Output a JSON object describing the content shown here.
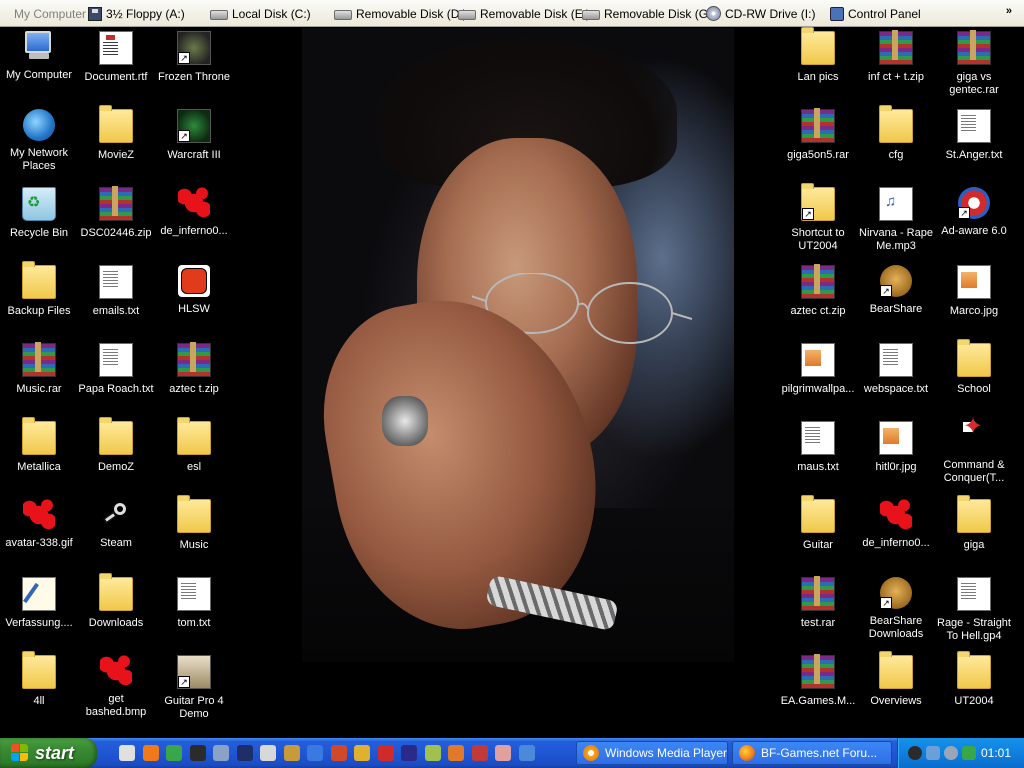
{
  "toolbar": {
    "items": [
      {
        "label": "My Computer",
        "icon": "computer-icon"
      },
      {
        "label": "3½ Floppy (A:)",
        "icon": "floppy-icon"
      },
      {
        "label": "Local Disk (C:)",
        "icon": "drive-icon"
      },
      {
        "label": "Removable Disk (D:)",
        "icon": "drive-icon"
      },
      {
        "label": "Removable Disk (E:)",
        "icon": "drive-icon"
      },
      {
        "label": "Removable Disk (G:)",
        "icon": "drive-icon"
      },
      {
        "label": "CD-RW Drive (I:)",
        "icon": "cd-icon"
      },
      {
        "label": "Control Panel",
        "icon": "control-panel-icon"
      }
    ],
    "more": "»"
  },
  "desktop": {
    "left_icons": [
      {
        "label": "My Computer",
        "icon": "my-computer-icon"
      },
      {
        "label": "Document.rtf",
        "icon": "document-icon"
      },
      {
        "label": "Frozen Throne",
        "icon": "frozen-throne-icon"
      },
      {
        "label": "My Network Places",
        "icon": "network-icon"
      },
      {
        "label": "MovieZ",
        "icon": "folder-icon"
      },
      {
        "label": "Warcraft III",
        "icon": "warcraft-icon"
      },
      {
        "label": "Recycle Bin",
        "icon": "recycle-bin-icon"
      },
      {
        "label": "DSC02446.zip",
        "icon": "archive-icon"
      },
      {
        "label": "de_inferno0...",
        "icon": "splat-icon"
      },
      {
        "label": "Backup Files",
        "icon": "folder-icon"
      },
      {
        "label": "emails.txt",
        "icon": "text-file-icon"
      },
      {
        "label": "HLSW",
        "icon": "hlsw-icon"
      },
      {
        "label": "Music.rar",
        "icon": "archive-icon"
      },
      {
        "label": "Papa Roach.txt",
        "icon": "text-file-icon"
      },
      {
        "label": "aztec t.zip",
        "icon": "archive-icon"
      },
      {
        "label": "Metallica",
        "icon": "folder-icon"
      },
      {
        "label": "DemoZ",
        "icon": "folder-icon"
      },
      {
        "label": "esl",
        "icon": "folder-icon"
      },
      {
        "label": "avatar-338.gif",
        "icon": "splat-icon"
      },
      {
        "label": "Steam",
        "icon": "steam-icon"
      },
      {
        "label": "Music",
        "icon": "folder-icon"
      },
      {
        "label": "Verfassung....",
        "icon": "pen-document-icon"
      },
      {
        "label": "Downloads",
        "icon": "folder-icon"
      },
      {
        "label": "tom.txt",
        "icon": "text-file-icon"
      },
      {
        "label": "4ll",
        "icon": "folder-icon"
      },
      {
        "label": "get bashed.bmp",
        "icon": "splat-icon"
      },
      {
        "label": "Guitar Pro 4 Demo",
        "icon": "guitar-pro-icon"
      }
    ],
    "right_icons": [
      {
        "label": "Lan pics",
        "icon": "folder-icon"
      },
      {
        "label": "inf ct + t.zip",
        "icon": "archive-icon"
      },
      {
        "label": "giga vs gentec.rar",
        "icon": "archive-icon"
      },
      {
        "label": "giga5on5.rar",
        "icon": "archive-icon"
      },
      {
        "label": "cfg",
        "icon": "folder-icon"
      },
      {
        "label": "St.Anger.txt",
        "icon": "text-file-icon"
      },
      {
        "label": "Shortcut to UT2004",
        "icon": "folder-icon"
      },
      {
        "label": "Nirvana - Rape Me.mp3",
        "icon": "mp3-icon"
      },
      {
        "label": "Ad-aware 6.0",
        "icon": "adaware-icon"
      },
      {
        "label": "aztec ct.zip",
        "icon": "archive-icon"
      },
      {
        "label": "BearShare",
        "icon": "bearshare-icon"
      },
      {
        "label": "Marco.jpg",
        "icon": "image-file-icon"
      },
      {
        "label": "pilgrimwallpa...",
        "icon": "image-file-icon"
      },
      {
        "label": "webspace.txt",
        "icon": "text-file-icon"
      },
      {
        "label": "School",
        "icon": "folder-icon"
      },
      {
        "label": "maus.txt",
        "icon": "text-file-icon"
      },
      {
        "label": "hitl0r.jpg",
        "icon": "image-file-icon"
      },
      {
        "label": "Command & Conquer(T...",
        "icon": "command-conquer-icon"
      },
      {
        "label": "Guitar",
        "icon": "folder-icon"
      },
      {
        "label": "de_inferno0...",
        "icon": "splat-icon"
      },
      {
        "label": "giga",
        "icon": "folder-icon"
      },
      {
        "label": "test.rar",
        "icon": "archive-icon"
      },
      {
        "label": "BearShare Downloads",
        "icon": "bearshare-icon"
      },
      {
        "label": "Rage - Straight To Hell.gp4",
        "icon": "text-file-icon"
      },
      {
        "label": "EA.Games.M...",
        "icon": "archive-icon"
      },
      {
        "label": "Overviews",
        "icon": "folder-icon"
      },
      {
        "label": "UT2004",
        "icon": "folder-icon"
      }
    ]
  },
  "taskbar": {
    "start_label": "start",
    "tasks": [
      {
        "label": "Windows Media Player",
        "icon": "media-player-icon"
      },
      {
        "label": "BF-Games.net Foru...",
        "icon": "firefox-icon"
      }
    ],
    "clock": "01:01"
  }
}
